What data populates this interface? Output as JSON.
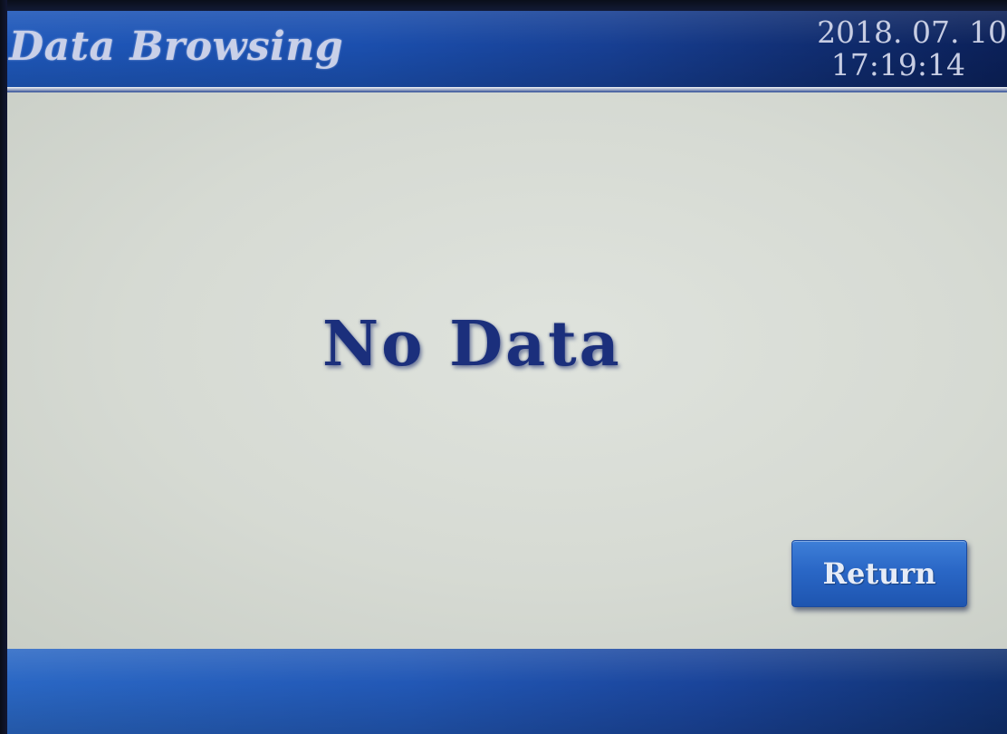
{
  "header": {
    "title": "Data Browsing",
    "date": "2018. 07. 10",
    "time": "17:19:14"
  },
  "main": {
    "message": "No Data"
  },
  "actions": {
    "return_label": "Return"
  },
  "colors": {
    "header_blue": "#1e57b9",
    "text_navy": "#1b2f7c",
    "button_blue": "#2a67c6",
    "background": "#d7dbd6"
  }
}
